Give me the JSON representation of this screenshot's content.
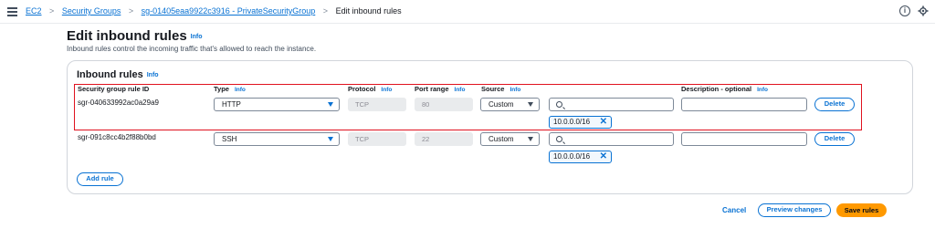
{
  "breadcrumb": {
    "items": [
      "EC2",
      "Security Groups",
      "sg-01405eaa9922c3916 - PrivateSecurityGroup"
    ],
    "current": "Edit inbound rules",
    "separator": ">"
  },
  "header": {
    "title": "Edit inbound rules",
    "info": "Info",
    "description": "Inbound rules control the incoming traffic that's allowed to reach the instance."
  },
  "panel": {
    "title": "Inbound rules",
    "info": "Info",
    "columns": {
      "rule_id": "Security group rule ID",
      "type": "Type",
      "protocol": "Protocol",
      "port_range": "Port range",
      "source": "Source",
      "description": "Description - optional"
    },
    "info_label": "Info",
    "rows": [
      {
        "rule_id": "sgr-040633992ac0a29a9",
        "type": "HTTP",
        "protocol": "TCP",
        "port_range": "80",
        "source_type": "Custom",
        "source_search": "",
        "cidr": "10.0.0.0/16",
        "description": "",
        "delete_label": "Delete"
      },
      {
        "rule_id": "sgr-091c8cc4b2f88b0bd",
        "type": "SSH",
        "protocol": "TCP",
        "port_range": "22",
        "source_type": "Custom",
        "source_search": "",
        "cidr": "10.0.0.0/16",
        "description": "",
        "delete_label": "Delete"
      }
    ],
    "add_rule_label": "Add rule"
  },
  "footer": {
    "cancel_label": "Cancel",
    "preview_label": "Preview changes",
    "save_label": "Save rules"
  },
  "colors": {
    "link": "#0972d3",
    "primary": "#ff9900",
    "highlight": "#e0121f"
  }
}
